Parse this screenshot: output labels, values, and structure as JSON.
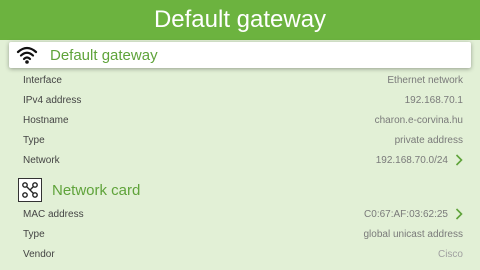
{
  "header": {
    "title": "Default gateway"
  },
  "gateway_section": {
    "title": "Default gateway",
    "icon": "wifi-icon",
    "rows": [
      {
        "label": "Interface",
        "value": "Ethernet network"
      },
      {
        "label": "IPv4 address",
        "value": "192.168.70.1"
      },
      {
        "label": "Hostname",
        "value": "charon.e-corvina.hu"
      },
      {
        "label": "Type",
        "value": "private address"
      },
      {
        "label": "Network",
        "value": "192.168.70.0/24"
      }
    ]
  },
  "network_card_section": {
    "title": "Network card",
    "icon": "network-card-icon",
    "rows": [
      {
        "label": "MAC address",
        "value": "C0:67:AF:03:62:25"
      },
      {
        "label": "Type",
        "value": "global unicast address"
      },
      {
        "label": "Vendor",
        "value": "Cisco"
      }
    ]
  },
  "colors": {
    "accent": "#6cb33f",
    "background": "#e2f0d6"
  }
}
